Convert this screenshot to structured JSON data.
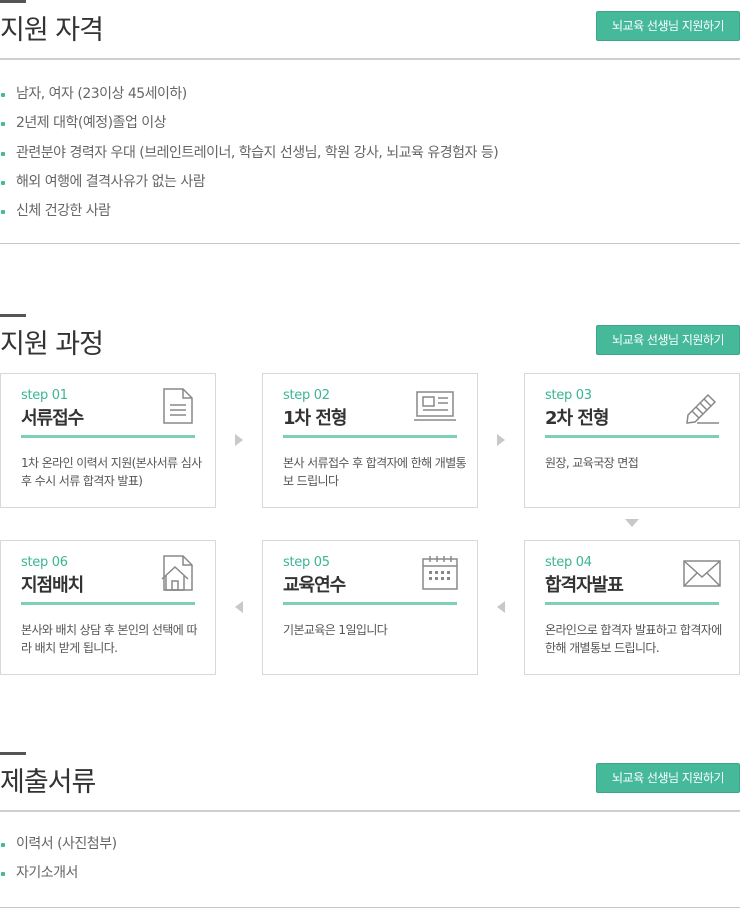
{
  "apply_label": "뇌교육 선생님 지원하기",
  "qualification": {
    "title": "지원 자격",
    "items": [
      "남자, 여자 (23이상 45세이하)",
      "2년제 대학(예정)졸업 이상",
      "관련분야 경력자 우대 (브레인트레이너, 학습지 선생님, 학원 강사, 뇌교육 유경험자 등)",
      "해외 여행에 결격사유가 없는 사람",
      "신체 건강한 사람"
    ]
  },
  "process": {
    "title": "지원 과정",
    "steps": [
      {
        "num": "step 01",
        "name": "서류접수",
        "desc": "1차 온라인 이력서 지원(본사서류 심사 후 수시 서류 합격자 발표)",
        "icon": "document-icon"
      },
      {
        "num": "step 02",
        "name": "1차 전형",
        "desc": "본사 서류접수 후 합격자에 한해 개별통보 드립니다",
        "icon": "newspaper-icon"
      },
      {
        "num": "step 03",
        "name": "2차 전형",
        "desc": "원장, 교육국장 면접",
        "icon": "pencil-icon"
      },
      {
        "num": "step 04",
        "name": "합격자발표",
        "desc": "온라인으로 합격자 발표하고 합격자에 한해 개별통보 드립니다.",
        "icon": "envelope-icon"
      },
      {
        "num": "step 05",
        "name": "교육연수",
        "desc": "기본교육은 1일입니다",
        "icon": "calendar-icon"
      },
      {
        "num": "step 06",
        "name": "지점배치",
        "desc": "본사와 배치 상담 후 본인의 선택에 따라 배치 받게 됩니다.",
        "icon": "house-document-icon"
      }
    ]
  },
  "documents": {
    "title": "제출서류",
    "items": [
      "이력서 (사진첨부)",
      "자기소개서"
    ]
  },
  "colors": {
    "accent": "#45b99a",
    "step_underline": "#7fcfb5",
    "step_number": "#3bb593"
  }
}
